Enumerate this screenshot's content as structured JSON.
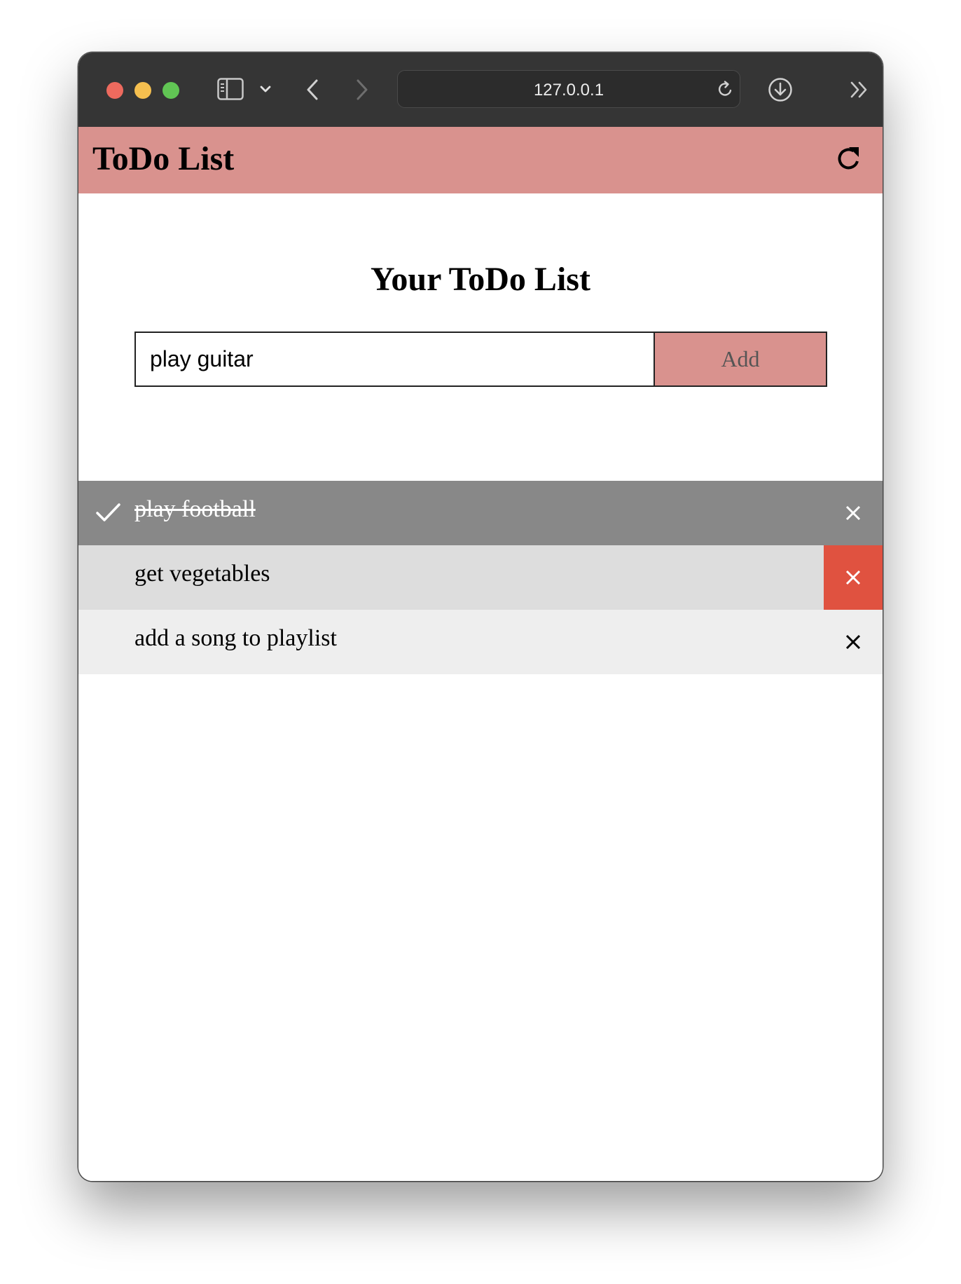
{
  "browser": {
    "url": "127.0.0.1",
    "icons": [
      "sidebar-icon",
      "chevron-down-icon",
      "back-icon",
      "forward-icon",
      "reload-icon",
      "download-icon",
      "chevrons-right-icon"
    ]
  },
  "app": {
    "title": "ToDo List",
    "refresh_icon": "refresh-icon"
  },
  "main": {
    "heading": "Your ToDo List",
    "input_value": "play guitar",
    "add_label": "Add"
  },
  "todos": [
    {
      "text": "play football",
      "checked": true
    },
    {
      "text": "get vegetables",
      "checked": false
    },
    {
      "text": "add a song to playlist",
      "checked": false
    }
  ],
  "colors": {
    "accent": "#d9928e",
    "checked_row": "#888888",
    "hover_row": "#dddddd",
    "row": "#eeeeee",
    "delete_hover": "#e05240"
  }
}
